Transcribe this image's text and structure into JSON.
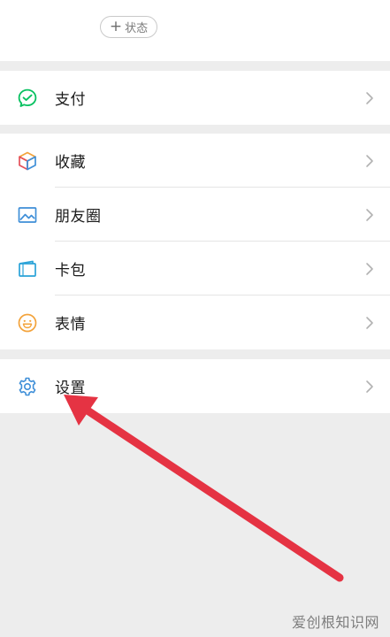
{
  "profile": {
    "status_button_plus": "+",
    "status_button_label": "状态"
  },
  "menu": {
    "pay": {
      "label": "支付",
      "icon": "pay-icon"
    },
    "favorites": {
      "label": "收藏",
      "icon": "favorites-cube-icon"
    },
    "moments": {
      "label": "朋友圈",
      "icon": "moments-image-icon"
    },
    "cards": {
      "label": "卡包",
      "icon": "card-wallet-icon"
    },
    "stickers": {
      "label": "表情",
      "icon": "smiley-icon"
    },
    "settings": {
      "label": "设置",
      "icon": "gear-icon"
    }
  },
  "colors": {
    "pay_green": "#07c160",
    "moments_blue": "#3f8fd8",
    "cards_blue": "#2aa3d8",
    "stickers_orange": "#f3a33b",
    "settings_blue": "#3f8fd8",
    "arrow_red": "#e53343"
  },
  "watermark": "爱创根知识网"
}
